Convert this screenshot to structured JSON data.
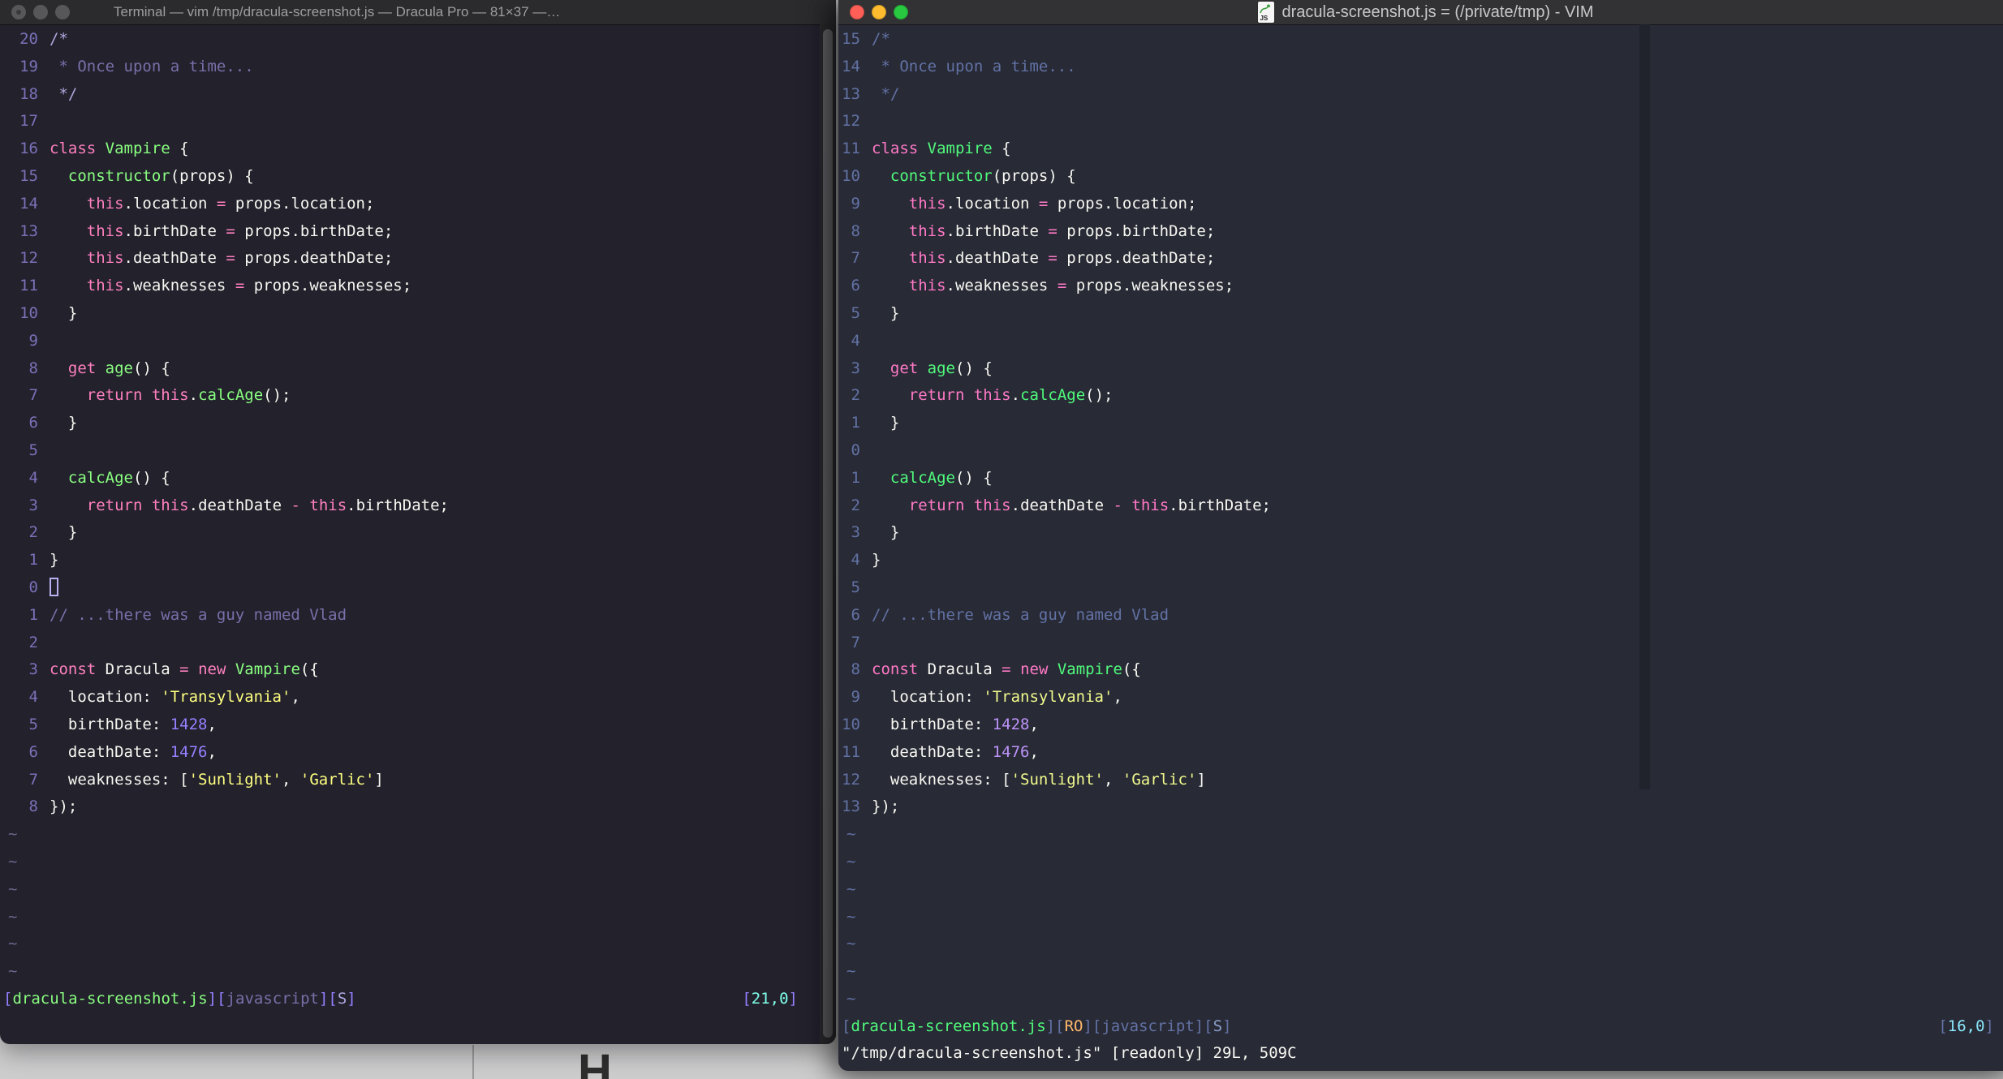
{
  "desktop": {
    "bg": "#CDCDCE",
    "fragment_text": "H"
  },
  "code_lines": [
    [
      [
        "delim",
        "/*"
      ]
    ],
    [
      [
        "comment",
        " * Once upon a time..."
      ]
    ],
    [
      [
        "delim",
        " */"
      ]
    ],
    [],
    [
      [
        "pink",
        "class"
      ],
      [
        "fg",
        " "
      ],
      [
        "green",
        "Vampire"
      ],
      [
        "fg",
        " {"
      ]
    ],
    [
      [
        "fg",
        "  "
      ],
      [
        "green",
        "constructor"
      ],
      [
        "fg",
        "(props) {"
      ]
    ],
    [
      [
        "fg",
        "    "
      ],
      [
        "pink",
        "this"
      ],
      [
        "fg",
        ".location "
      ],
      [
        "pink",
        "="
      ],
      [
        "fg",
        " props.location;"
      ]
    ],
    [
      [
        "fg",
        "    "
      ],
      [
        "pink",
        "this"
      ],
      [
        "fg",
        ".birthDate "
      ],
      [
        "pink",
        "="
      ],
      [
        "fg",
        " props.birthDate;"
      ]
    ],
    [
      [
        "fg",
        "    "
      ],
      [
        "pink",
        "this"
      ],
      [
        "fg",
        ".deathDate "
      ],
      [
        "pink",
        "="
      ],
      [
        "fg",
        " props.deathDate;"
      ]
    ],
    [
      [
        "fg",
        "    "
      ],
      [
        "pink",
        "this"
      ],
      [
        "fg",
        ".weaknesses "
      ],
      [
        "pink",
        "="
      ],
      [
        "fg",
        " props.weaknesses;"
      ]
    ],
    [
      [
        "fg",
        "  }"
      ]
    ],
    [],
    [
      [
        "fg",
        "  "
      ],
      [
        "pink",
        "get"
      ],
      [
        "fg",
        " "
      ],
      [
        "green",
        "age"
      ],
      [
        "fg",
        "() {"
      ]
    ],
    [
      [
        "fg",
        "    "
      ],
      [
        "pink",
        "return"
      ],
      [
        "fg",
        " "
      ],
      [
        "pink",
        "this"
      ],
      [
        "fg",
        "."
      ],
      [
        "green",
        "calcAge"
      ],
      [
        "fg",
        "();"
      ]
    ],
    [
      [
        "fg",
        "  }"
      ]
    ],
    [],
    [
      [
        "fg",
        "  "
      ],
      [
        "green",
        "calcAge"
      ],
      [
        "fg",
        "() {"
      ]
    ],
    [
      [
        "fg",
        "    "
      ],
      [
        "pink",
        "return"
      ],
      [
        "fg",
        " "
      ],
      [
        "pink",
        "this"
      ],
      [
        "fg",
        ".deathDate "
      ],
      [
        "pink",
        "-"
      ],
      [
        "fg",
        " "
      ],
      [
        "pink",
        "this"
      ],
      [
        "fg",
        ".birthDate;"
      ]
    ],
    [
      [
        "fg",
        "  }"
      ]
    ],
    [
      [
        "fg",
        "}"
      ]
    ],
    [],
    [
      [
        "comment",
        "// ...there was a guy named Vlad"
      ]
    ],
    [],
    [
      [
        "pink",
        "const"
      ],
      [
        "fg",
        " Dracula "
      ],
      [
        "pink",
        "="
      ],
      [
        "fg",
        " "
      ],
      [
        "pink",
        "new"
      ],
      [
        "fg",
        " "
      ],
      [
        "green",
        "Vampire"
      ],
      [
        "fg",
        "({"
      ]
    ],
    [
      [
        "fg",
        "  location: "
      ],
      [
        "yellow",
        "'Transylvania'"
      ],
      [
        "fg",
        ","
      ]
    ],
    [
      [
        "fg",
        "  birthDate: "
      ],
      [
        "purple",
        "1428"
      ],
      [
        "fg",
        ","
      ]
    ],
    [
      [
        "fg",
        "  deathDate: "
      ],
      [
        "purple",
        "1476"
      ],
      [
        "fg",
        ","
      ]
    ],
    [
      [
        "fg",
        "  weaknesses: ["
      ],
      [
        "yellow",
        "'Sunlight'"
      ],
      [
        "fg",
        ", "
      ],
      [
        "yellow",
        "'Garlic'"
      ],
      [
        "fg",
        "]"
      ]
    ],
    [
      [
        "fg",
        "});"
      ]
    ]
  ],
  "left_window": {
    "title": "Terminal — vim /tmp/dracula-screenshot.js — Dracula Pro — 81×37 —…",
    "palette": {
      "bg": "#22212C",
      "titlebar": "#2B2B2D",
      "titletext": "#9E9EA0",
      "fg": "#F8F8F2",
      "comment": "#7970A9",
      "delim": "#AFA7DC",
      "pink": "#FF80BF",
      "green": "#8AFF80",
      "purple": "#9580FF",
      "yellow": "#FFFF80",
      "linenr": "#7B71B8",
      "tilde": "#6C678E",
      "bracket": "#9580FF",
      "file": "#8AFF80",
      "lang": "#7970A9",
      "flag": "#AFA9E2",
      "ro": "#FFB86C",
      "pos": "#80FFEA",
      "cursor": "#B9B1F0",
      "colorcolumn": "#22212C"
    },
    "line_numbers": [
      "20",
      "19",
      "18",
      "17",
      "16",
      "15",
      "14",
      "13",
      "12",
      "11",
      "10",
      "9",
      "8",
      "7",
      "6",
      "5",
      "4",
      "3",
      "2",
      "1",
      "0",
      "1",
      "2",
      "3",
      "4",
      "5",
      "6",
      "7",
      "8"
    ],
    "cursor": {
      "row": 20,
      "style": "hollow"
    },
    "tilde_count": 6,
    "status_segments": [
      [
        "bracket",
        "["
      ],
      [
        "file",
        "dracula-screenshot.js"
      ],
      [
        "bracket",
        "]["
      ],
      [
        "lang",
        "javascript"
      ],
      [
        "bracket",
        "]["
      ],
      [
        "flag",
        "S"
      ],
      [
        "bracket",
        "]"
      ]
    ],
    "ruler_segments": [
      [
        "bracket",
        "["
      ],
      [
        "pos",
        "21,0"
      ],
      [
        "bracket",
        "]"
      ]
    ],
    "status2": null
  },
  "right_window": {
    "title": "dracula-screenshot.js = (/private/tmp) - VIM",
    "icon_label": "JS",
    "palette": {
      "bg": "#282A36",
      "titlebar": "#323234",
      "titletext": "#C8C8CA",
      "fg": "#F8F8F2",
      "comment": "#6272A4",
      "delim": "#6272A4",
      "pink": "#FF79C6",
      "green": "#50FA7B",
      "purple": "#BD93F9",
      "yellow": "#F1FA8C",
      "linenr": "#6272A4",
      "tilde": "#6272A4",
      "bracket": "#6272A4",
      "file": "#50FA7B",
      "lang": "#6272A4",
      "flag": "#8BA0CC",
      "ro": "#FFB86C",
      "pos": "#8BE9FD",
      "cursor": "#F8F8F2",
      "colorcolumn": "#20222C"
    },
    "line_numbers": [
      "15",
      "14",
      "13",
      "12",
      "11",
      "10",
      "9",
      "8",
      "7",
      "6",
      "5",
      "4",
      "3",
      "2",
      "1",
      "0",
      "1",
      "2",
      "3",
      "4",
      "5",
      "6",
      "7",
      "8",
      "9",
      "10",
      "11",
      "12",
      "13"
    ],
    "cursor": null,
    "tilde_count": 7,
    "status_segments": [
      [
        "bracket",
        "["
      ],
      [
        "file",
        "dracula-screenshot.js"
      ],
      [
        "bracket",
        "]["
      ],
      [
        "ro",
        "RO"
      ],
      [
        "bracket",
        "]["
      ],
      [
        "lang",
        "javascript"
      ],
      [
        "bracket",
        "]["
      ],
      [
        "flag",
        "S"
      ],
      [
        "bracket",
        "]"
      ]
    ],
    "ruler_segments": [
      [
        "bracket",
        "["
      ],
      [
        "pos",
        "16,0"
      ],
      [
        "bracket",
        "]"
      ]
    ],
    "status2": "\"/tmp/dracula-screenshot.js\" [readonly] 29L, 509C"
  }
}
